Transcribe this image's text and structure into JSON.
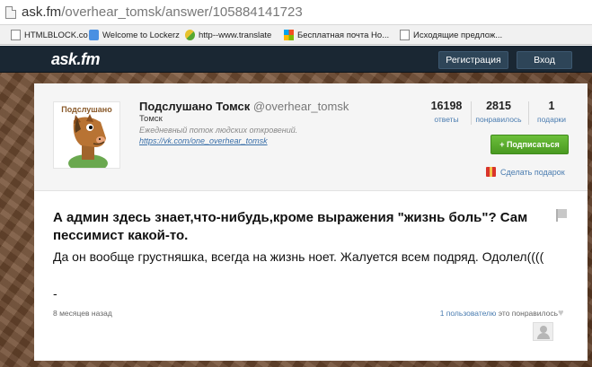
{
  "browser": {
    "url_host": "ask.fm",
    "url_path": "/overhear_tomsk/answer/105884141723",
    "bookmarks": [
      {
        "label": "HTMLBLOCK.co",
        "icon": "page-icon"
      },
      {
        "label": "Welcome to Lockerz",
        "icon": "lockerz-icon"
      },
      {
        "label": "http--www.translate",
        "icon": "yandex-icon"
      },
      {
        "label": "Бесплатная почта Ho...",
        "icon": "windows-icon"
      },
      {
        "label": "Исходящие предлож...",
        "icon": "page-icon"
      }
    ]
  },
  "header": {
    "logo": "ask.fm",
    "register_label": "Регистрация",
    "login_label": "Вход"
  },
  "profile": {
    "avatar_caption": "Подслушано",
    "name": "Подслушано Томск",
    "username": "@overhear_tomsk",
    "city": "Томск",
    "bio": "Ежедневный поток людских откровений.",
    "link": "https://vk.com/one_overhear_tomsk",
    "stats": [
      {
        "value": "16198",
        "label": "ответы"
      },
      {
        "value": "2815",
        "label": "понравилось"
      },
      {
        "value": "1",
        "label": "подарки"
      }
    ],
    "subscribe_label": "+ Подписаться",
    "gift_label": "Сделать подарок"
  },
  "answer": {
    "question": "А админ здесь знает,что-нибудь,кроме выражения \"жизнь боль\"? Сам пессимист какой-то.",
    "answer_text": "Да он вообще грустняшка, всегда на жизнь ноет. Жалуется всем подряд. Одолел((((",
    "dash": "-",
    "time_ago": "8 месяцев назад",
    "likes_link": "1 пользователю",
    "likes_suffix": " это понравилось"
  },
  "colors": {
    "header_bg": "#1a2733",
    "subscribe_green": "#4a9a21",
    "link_blue": "#4a7cb0"
  }
}
